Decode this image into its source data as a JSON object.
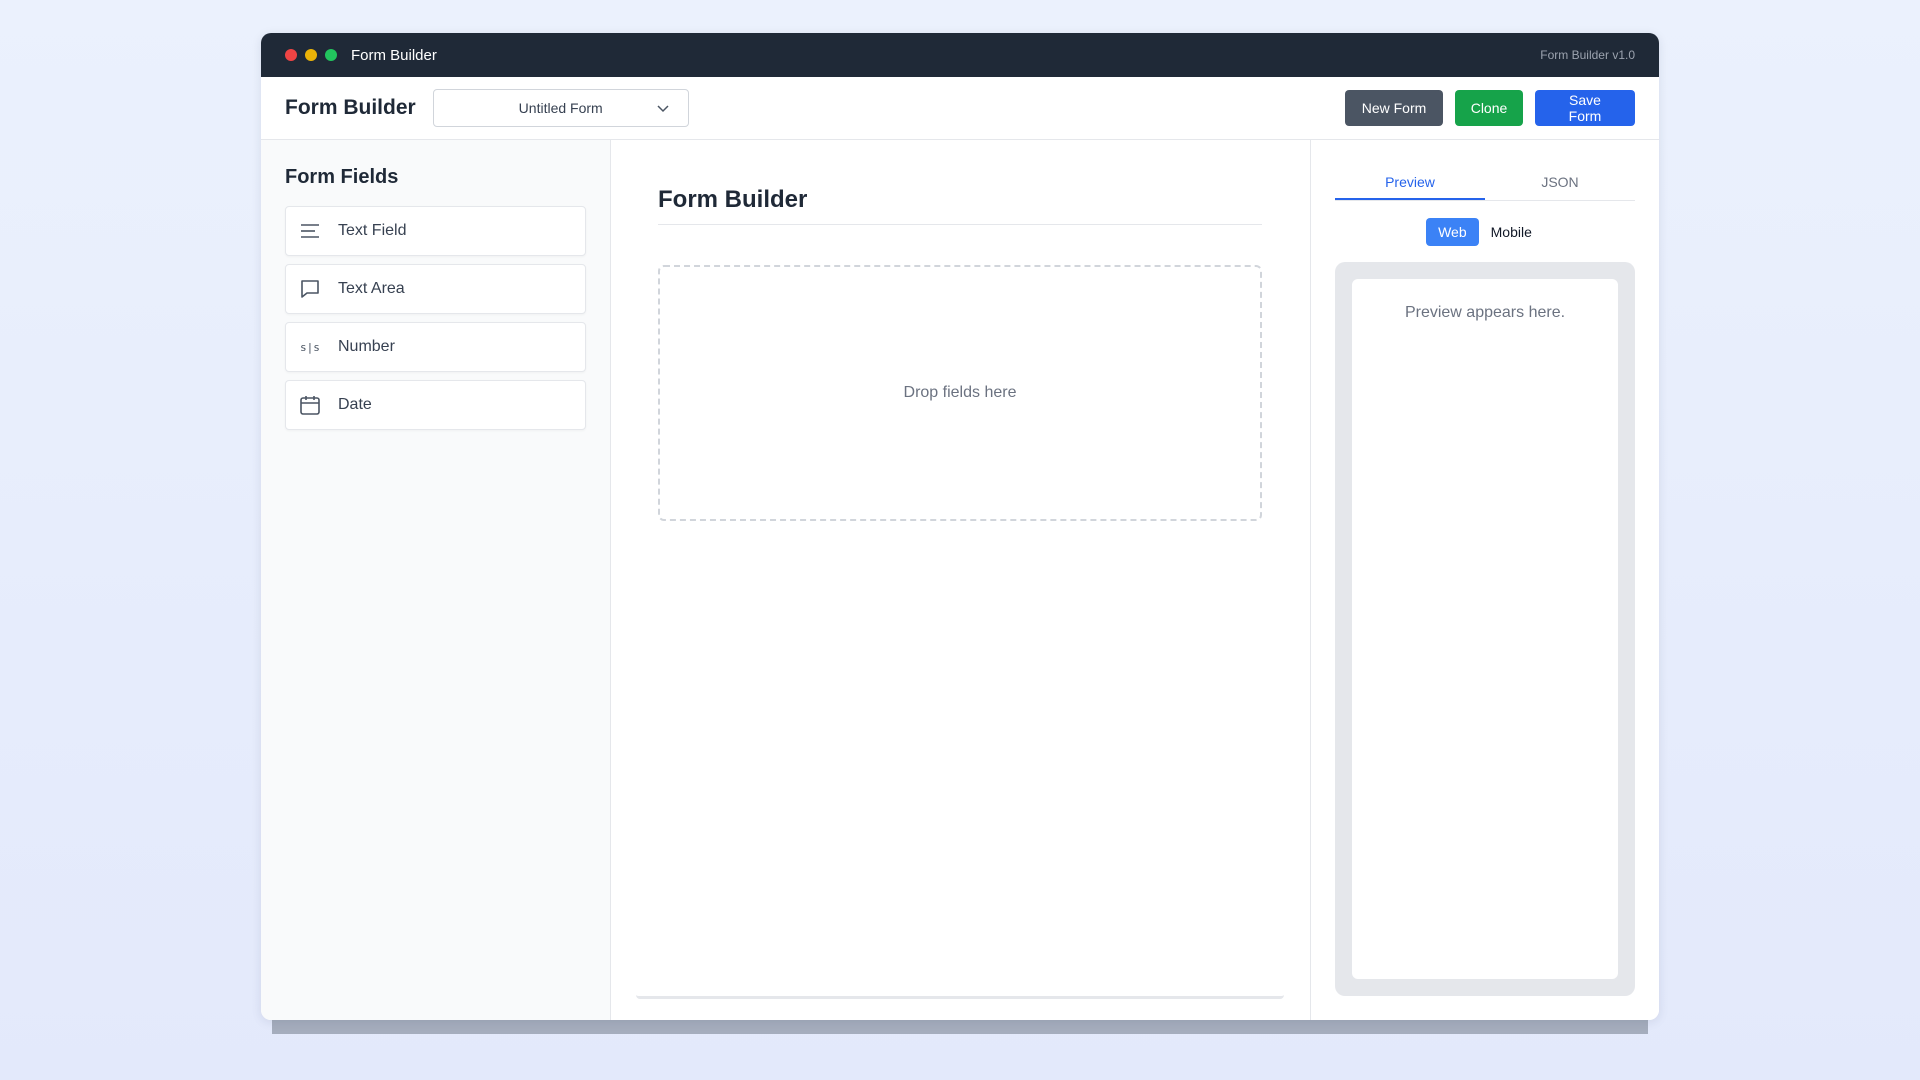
{
  "window": {
    "title": "Form Builder",
    "version": "Form Builder v1.0"
  },
  "toolbar": {
    "app_name": "Form Builder",
    "form_select_value": "Untitled Form",
    "new_form_label": "New Form",
    "clone_label": "Clone",
    "save_form_label": "Save Form"
  },
  "sidebar": {
    "heading": "Form Fields",
    "items": [
      {
        "label": "Text Field",
        "icon": "text-lines-icon"
      },
      {
        "label": "Text Area",
        "icon": "speech-bubble-icon"
      },
      {
        "label": "Number",
        "icon": "number-icon",
        "glyph": "⅟⅟"
      },
      {
        "label": "Date",
        "icon": "calendar-icon"
      }
    ]
  },
  "canvas": {
    "title": "Form Builder",
    "dropzone_text": "Drop fields here"
  },
  "preview": {
    "tabs": [
      {
        "label": "Preview",
        "active": true
      },
      {
        "label": "JSON",
        "active": false
      }
    ],
    "modes": [
      {
        "label": "Web",
        "active": true
      },
      {
        "label": "Mobile",
        "active": false
      }
    ],
    "placeholder": "Preview appears here."
  },
  "colors": {
    "titlebar": "#1f2937",
    "primary": "#2563eb",
    "success": "#16a34a",
    "neutral": "#4b5563"
  }
}
